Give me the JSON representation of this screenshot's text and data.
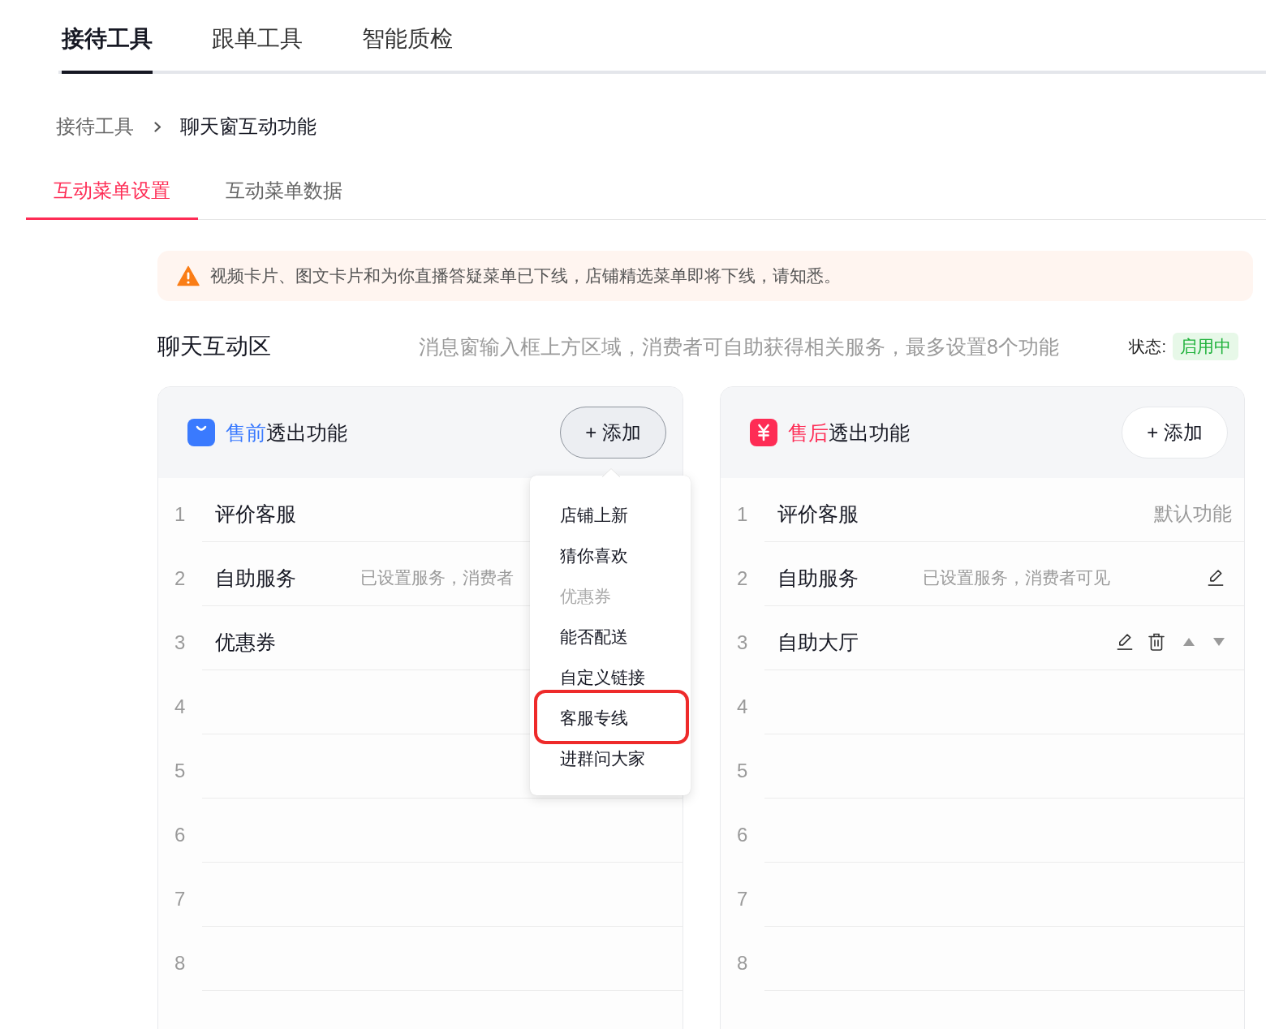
{
  "top_tabs": [
    {
      "label": "接待工具",
      "selected": true
    },
    {
      "label": "跟单工具",
      "selected": false
    },
    {
      "label": "智能质检",
      "selected": false
    }
  ],
  "breadcrumb": [
    "接待工具",
    "聊天窗互动功能"
  ],
  "sub_tabs": [
    {
      "label": "互动菜单设置",
      "selected": true
    },
    {
      "label": "互动菜单数据",
      "selected": false
    }
  ],
  "notice": {
    "text": "视频卡片、图文卡片和为你直播答疑菜单已下线，店铺精选菜单即将下线，请知悉。"
  },
  "section": {
    "title": "聊天互动区",
    "description": "消息窗输入框上方区域，消费者可自助获得相关服务，最多设置8个功能",
    "status": {
      "label": "状态:",
      "value": "启用中",
      "enabled": true
    }
  },
  "panels": [
    {
      "kind": "presale",
      "color": "#3a7afe",
      "title_accent": "售前",
      "title_rest": "透出功能",
      "add_button": {
        "label": "+ 添加",
        "expanded": true
      },
      "rows": [
        {
          "number": "1",
          "name": "评价客服",
          "editable": false,
          "deletable": false,
          "movable": false
        },
        {
          "number": "2",
          "name": "自助服务",
          "description": "已设置服务，消费者",
          "editable": false,
          "deletable": false,
          "movable": false
        },
        {
          "number": "3",
          "name": "优惠券",
          "editable": false,
          "deletable": false,
          "movable": false
        },
        {
          "number": "4",
          "editable": false,
          "deletable": false,
          "movable": false
        },
        {
          "number": "5",
          "editable": false,
          "deletable": false,
          "movable": false
        },
        {
          "number": "6",
          "editable": false,
          "deletable": false,
          "movable": false
        },
        {
          "number": "7",
          "editable": false,
          "deletable": false,
          "movable": false
        },
        {
          "number": "8",
          "editable": false,
          "deletable": false,
          "movable": false
        }
      ],
      "add_menu": {
        "items": [
          {
            "label": "店铺上新",
            "disabled": false,
            "highlighted": false
          },
          {
            "label": "猜你喜欢",
            "disabled": false,
            "highlighted": false
          },
          {
            "label": "优惠券",
            "disabled": true,
            "highlighted": false
          },
          {
            "label": "能否配送",
            "disabled": false,
            "highlighted": false
          },
          {
            "label": "自定义链接",
            "disabled": false,
            "highlighted": false
          },
          {
            "label": "客服专线",
            "disabled": false,
            "highlighted": true
          },
          {
            "label": "进群问大家",
            "disabled": false,
            "highlighted": false
          }
        ]
      }
    },
    {
      "kind": "aftersale",
      "color": "#fe2c55",
      "title_accent": "售后",
      "title_rest": "透出功能",
      "add_button": {
        "label": "+ 添加",
        "expanded": false
      },
      "rows": [
        {
          "number": "1",
          "name": "评价客服",
          "note": "默认功能",
          "editable": false,
          "deletable": false,
          "movable": false
        },
        {
          "number": "2",
          "name": "自助服务",
          "description": "已设置服务，消费者可见",
          "editable": true,
          "deletable": false,
          "movable": false
        },
        {
          "number": "3",
          "name": "自助大厅",
          "editable": true,
          "deletable": true,
          "movable": true
        },
        {
          "number": "4",
          "editable": false,
          "deletable": false,
          "movable": false
        },
        {
          "number": "5",
          "editable": false,
          "deletable": false,
          "movable": false
        },
        {
          "number": "6",
          "editable": false,
          "deletable": false,
          "movable": false
        },
        {
          "number": "7",
          "editable": false,
          "deletable": false,
          "movable": false
        },
        {
          "number": "8",
          "editable": false,
          "deletable": false,
          "movable": false
        }
      ]
    }
  ]
}
